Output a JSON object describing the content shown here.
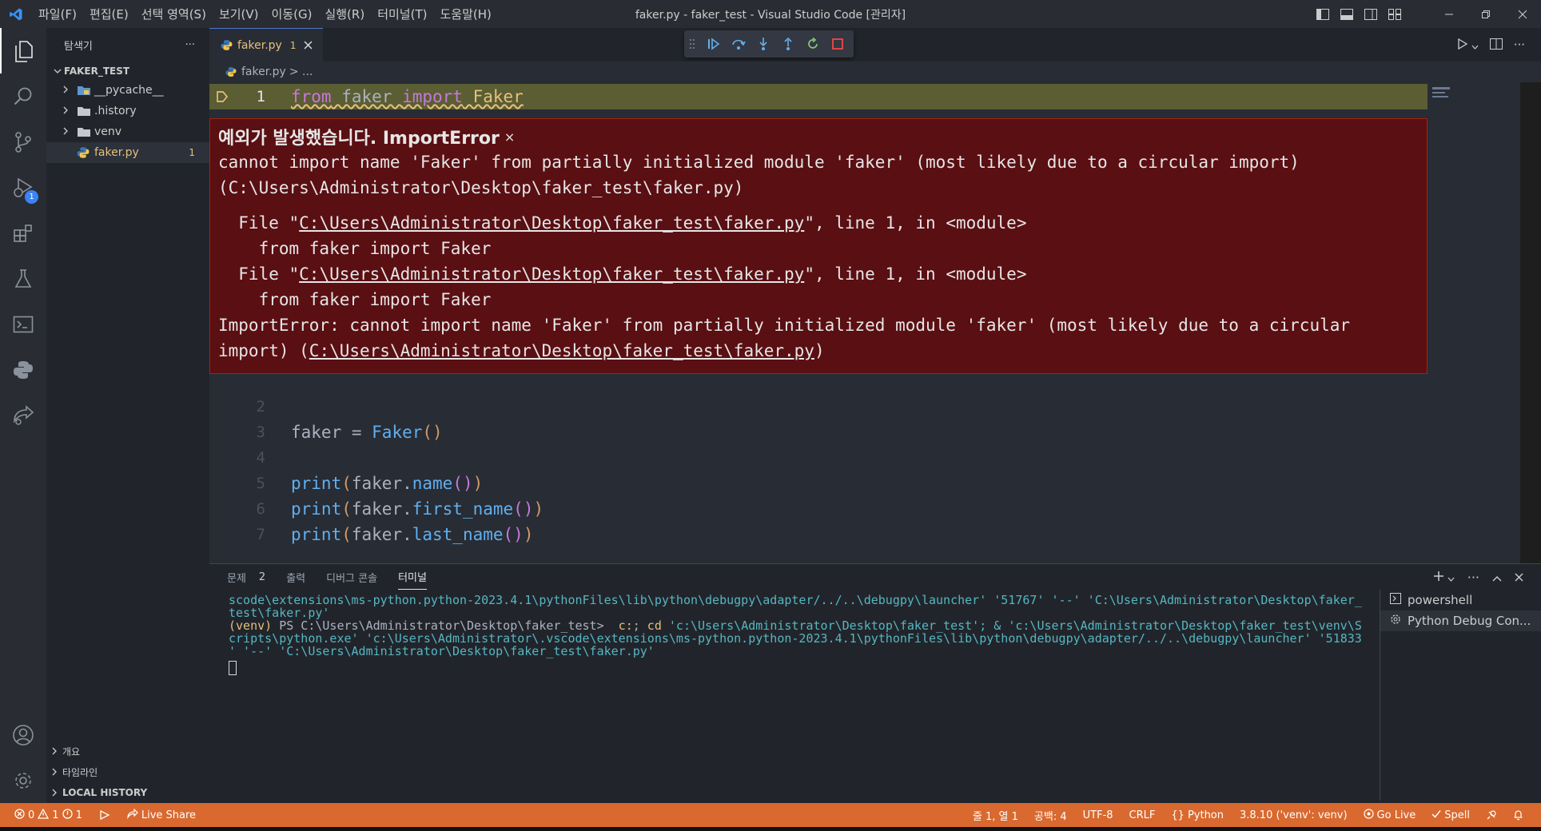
{
  "window": {
    "title": "faker.py - faker_test - Visual Studio Code [관리자]",
    "menus": [
      "파일(F)",
      "편집(E)",
      "선택 영역(S)",
      "보기(V)",
      "이동(G)",
      "실행(R)",
      "터미널(T)",
      "도움말(H)"
    ]
  },
  "activity": {
    "debug_badge": "1"
  },
  "sidebar": {
    "header": "탐색기",
    "more": "···",
    "root": "FAKER_TEST",
    "items": [
      {
        "label": "__pycache__",
        "kind": "folder"
      },
      {
        "label": ".history",
        "kind": "folder"
      },
      {
        "label": "venv",
        "kind": "folder"
      },
      {
        "label": "faker.py",
        "kind": "python-file",
        "count": "1"
      }
    ],
    "panels": [
      "개요",
      "타임라인",
      "LOCAL HISTORY"
    ]
  },
  "editor": {
    "tab": {
      "label": "faker.py",
      "problems": "1"
    },
    "breadcrumb": {
      "file": "faker.py",
      "rest": "> ..."
    },
    "lines": [
      {
        "n": "1",
        "tokens": [
          [
            "from",
            "kw"
          ],
          [
            " faker ",
            "id"
          ],
          [
            "import",
            "kw"
          ],
          [
            " Faker",
            "cls"
          ]
        ]
      },
      {
        "n": "2",
        "tokens": []
      },
      {
        "n": "3",
        "tokens": [
          [
            "faker",
            "id"
          ],
          [
            " = ",
            "id"
          ],
          [
            "Faker",
            "fn"
          ],
          [
            "()",
            "p1"
          ]
        ]
      },
      {
        "n": "4",
        "tokens": []
      },
      {
        "n": "5",
        "tokens": [
          [
            "print",
            "fn"
          ],
          [
            "(",
            "p1"
          ],
          [
            "faker.",
            "id"
          ],
          [
            "name",
            "fn"
          ],
          [
            "()",
            "p2"
          ],
          [
            ")",
            "p1"
          ]
        ]
      },
      {
        "n": "6",
        "tokens": [
          [
            "print",
            "fn"
          ],
          [
            "(",
            "p1"
          ],
          [
            "faker.",
            "id"
          ],
          [
            "first_name",
            "fn"
          ],
          [
            "()",
            "p2"
          ],
          [
            ")",
            "p1"
          ]
        ]
      },
      {
        "n": "7",
        "tokens": [
          [
            "print",
            "fn"
          ],
          [
            "(",
            "p1"
          ],
          [
            "faker.",
            "id"
          ],
          [
            "last_name",
            "fn"
          ],
          [
            "()",
            "p2"
          ],
          [
            ")",
            "p1"
          ]
        ]
      }
    ]
  },
  "exception": {
    "title": "예외가 발생했습니다. ImportError",
    "close": "×",
    "message_line1": "cannot import name 'Faker' from partially initialized module 'faker' (most likely due to a circular import)",
    "message_line2": "(C:\\Users\\Administrator\\Desktop\\faker_test\\faker.py)",
    "frame_prefix": "  File \"",
    "frame_path": "C:\\Users\\Administrator\\Desktop\\faker_test\\faker.py",
    "frame_suffix": "\", line 1, in <module>",
    "frame_code": "    from faker import Faker",
    "final_line1": "ImportError: cannot import name 'Faker' from partially initialized module 'faker' (most likely due to a circular",
    "final_line2_prefix": "import) (",
    "final_line2_path": "C:\\Users\\Administrator\\Desktop\\faker_test\\faker.py",
    "final_line2_suffix": ")"
  },
  "panel": {
    "tabs": [
      "문제",
      "출력",
      "디버그 콘솔",
      "터미널"
    ],
    "problems_count": "2",
    "active_tab": "터미널"
  },
  "terminal": {
    "l1": "scode\\extensions\\ms-python.python-2023.4.1\\pythonFiles\\lib\\python\\debugpy\\adapter/../..\\debugpy\\launcher' '51767' '--' 'C:\\Users\\Administrator\\Desktop\\faker_",
    "l2": "test\\faker.py'",
    "l3_venv": "(venv)",
    "l3_ps": " PS C:\\Users\\Administrator\\Desktop\\faker_test>  ",
    "l3_cmd1": "c:",
    "l3_mid": "; ",
    "l3_cd": "cd",
    "l3_rest": " 'c:\\Users\\Administrator\\Desktop\\faker_test'; & 'c:\\Users\\Administrator\\Desktop\\faker_test\\venv\\S",
    "l4": "cripts\\python.exe' 'c:\\Users\\Administrator\\.vscode\\extensions\\ms-python.python-2023.4.1\\pythonFiles\\lib\\python\\debugpy\\adapter/../..\\debugpy\\launcher' '51833",
    "l5": "' '--' 'C:\\Users\\Administrator\\Desktop\\faker_test\\faker.py'"
  },
  "terminals": [
    {
      "label": "powershell"
    },
    {
      "label": "Python Debug Con..."
    }
  ],
  "status": {
    "errors": "0",
    "warnings": "1",
    "infos": "1",
    "live_share": "Live Share",
    "position": "줄 1, 열 1",
    "spaces": "공백: 4",
    "encoding": "UTF-8",
    "eol": "CRLF",
    "language": "Python",
    "interpreter": "3.8.10 ('venv': venv)",
    "go_live": "Go Live",
    "spell": "Spell"
  },
  "colors": {
    "statusbar": "#d9692f",
    "error_bg": "#5a0f13",
    "accent": "#e5c07b"
  }
}
